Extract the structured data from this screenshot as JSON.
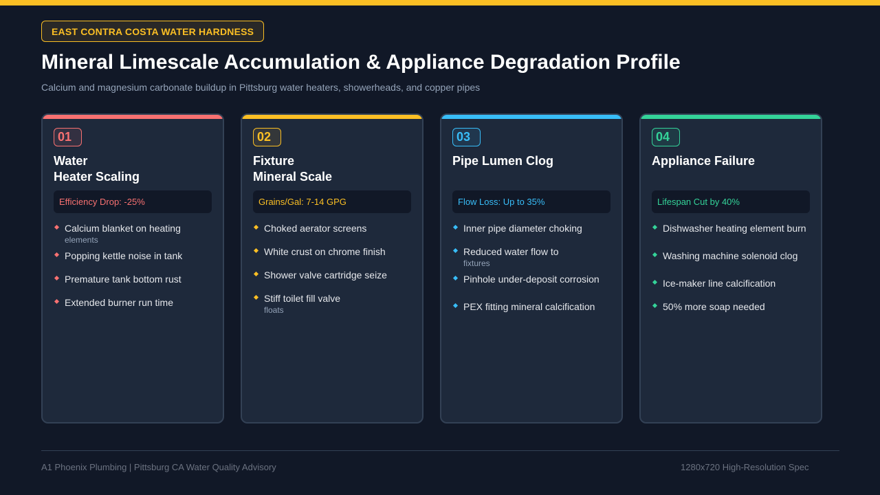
{
  "colors": {
    "accent": "#fbbf24",
    "background": "#111827",
    "card_bg": "#1e293b",
    "red": "#f87171",
    "yellow": "#fbbf24",
    "blue": "#38bdf8",
    "green": "#34d399"
  },
  "header": {
    "badge": "EAST CONTRA COSTA WATER HARDNESS",
    "title": "Mineral Limescale Accumulation & Appliance Degradation Profile",
    "subtitle": "Calcium and magnesium carbonate buildup in Pittsburg water heaters, showerheads, and copper pipes"
  },
  "cards": [
    {
      "number": "01",
      "title_line1": "Water",
      "title_line2": "Heater Scaling",
      "stat": "Efficiency Drop: -25%",
      "bullets": [
        {
          "text": "Calcium blanket on heating",
          "sub": "elements"
        },
        {
          "text": "Popping kettle noise in tank",
          "sub": ""
        },
        {
          "text": "Premature tank bottom rust",
          "sub": ""
        },
        {
          "text": "Extended burner run time",
          "sub": ""
        }
      ]
    },
    {
      "number": "02",
      "title_line1": "Fixture",
      "title_line2": "Mineral Scale",
      "stat": "Grains/Gal: 7-14 GPG",
      "bullets": [
        {
          "text": "Choked aerator screens",
          "sub": ""
        },
        {
          "text": "White crust on chrome finish",
          "sub": ""
        },
        {
          "text": "Shower valve cartridge seize",
          "sub": ""
        },
        {
          "text": "Stiff toilet fill valve",
          "sub": "floats"
        }
      ]
    },
    {
      "number": "03",
      "title_line1": "Pipe Lumen Clog",
      "title_line2": "",
      "stat": "Flow Loss: Up to 35%",
      "bullets": [
        {
          "text": "Inner pipe diameter choking",
          "sub": ""
        },
        {
          "text": "Reduced water flow to",
          "sub": "fixtures"
        },
        {
          "text": "Pinhole under-deposit corrosion",
          "sub": ""
        },
        {
          "text": "PEX fitting mineral calcification",
          "sub": ""
        }
      ]
    },
    {
      "number": "04",
      "title_line1": "Appliance Failure",
      "title_line2": "",
      "stat": "Lifespan Cut by 40%",
      "bullets": [
        {
          "text": "Dishwasher heating element burn",
          "sub": ""
        },
        {
          "text": "Washing machine solenoid clog",
          "sub": ""
        },
        {
          "text": "Ice-maker line calcification",
          "sub": ""
        },
        {
          "text": "50% more soap needed",
          "sub": ""
        }
      ]
    }
  ],
  "footer": {
    "left": "A1 Phoenix Plumbing | Pittsburg CA Water Quality Advisory",
    "right": "1280x720 High-Resolution Spec"
  }
}
